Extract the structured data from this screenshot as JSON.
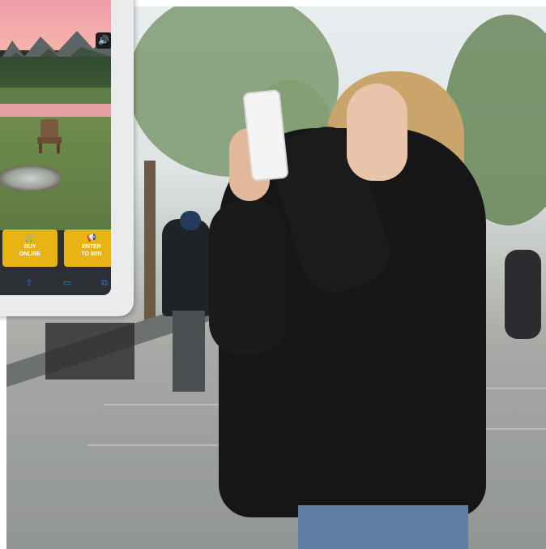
{
  "app": {
    "buttons": {
      "buy_online": {
        "icon": "cart-icon",
        "line1": "BUY",
        "line2": "ONLINE"
      },
      "enter_to_win": {
        "icon": "megaphone-icon",
        "line1": "ENTER",
        "line2": "TO WIN"
      }
    },
    "tab_bar": [
      {
        "icon": "share-icon"
      },
      {
        "icon": "camera-icon"
      },
      {
        "icon": "gallery-icon"
      }
    ],
    "accent_color": "#e8b415",
    "tab_icon_color": "#2a7bd5"
  }
}
